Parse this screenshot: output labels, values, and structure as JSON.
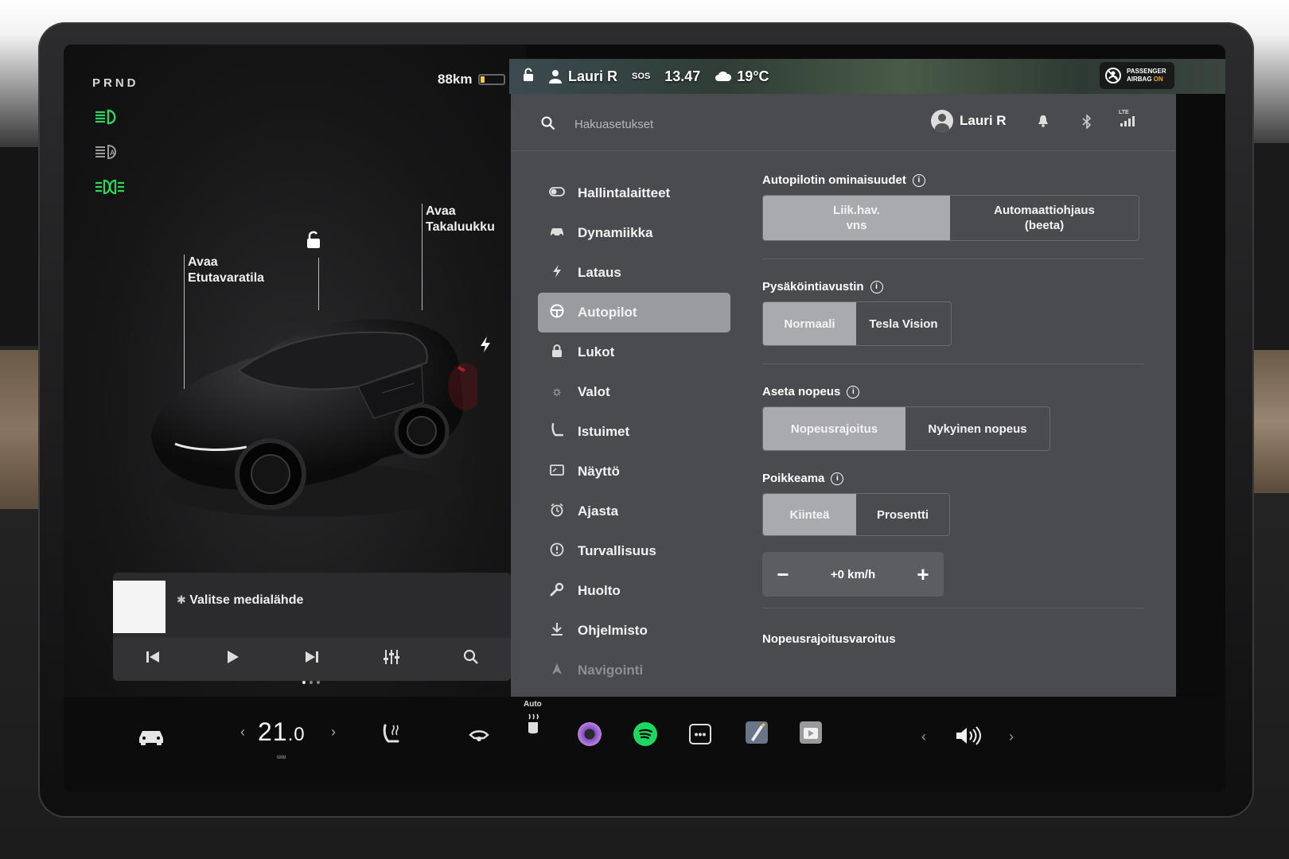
{
  "left": {
    "prnd": "PRND",
    "range": "88km",
    "callouts": {
      "frunk": [
        "Avaa",
        "Etutavaratila"
      ],
      "trunk": [
        "Avaa",
        "Takaluukku"
      ]
    },
    "media": {
      "source_label": "Valitse medialähde"
    }
  },
  "status": {
    "driver": "Lauri R",
    "sos": "SOS",
    "time": "13.47",
    "temperature": "19°C",
    "airbag_line1": "PASSENGER",
    "airbag_line2": "AIRBAG",
    "airbag_state": "ON"
  },
  "settings": {
    "search_placeholder": "Hakuasetukset",
    "user": "Lauri R",
    "lte": "LTE",
    "nav": [
      {
        "label": "Hallintalaitteet",
        "icon": "toggle-icon"
      },
      {
        "label": "Dynamiikka",
        "icon": "car-icon"
      },
      {
        "label": "Lataus",
        "icon": "bolt-icon"
      },
      {
        "label": "Autopilot",
        "icon": "steering-wheel-icon"
      },
      {
        "label": "Lukot",
        "icon": "lock-icon"
      },
      {
        "label": "Valot",
        "icon": "sun-icon"
      },
      {
        "label": "Istuimet",
        "icon": "seat-icon"
      },
      {
        "label": "Näyttö",
        "icon": "display-icon"
      },
      {
        "label": "Ajasta",
        "icon": "alarm-clock-icon"
      },
      {
        "label": "Turvallisuus",
        "icon": "alert-icon"
      },
      {
        "label": "Huolto",
        "icon": "wrench-icon"
      },
      {
        "label": "Ohjelmisto",
        "icon": "download-icon"
      },
      {
        "label": "Navigointi",
        "icon": "navigation-icon"
      }
    ],
    "active_nav": "Autopilot",
    "sections": {
      "autopilot_features": {
        "title": "Autopilotin ominaisuudet",
        "options": [
          "Liik.hav.\nvns",
          "Automaattiohjaus\n(beeta)"
        ],
        "selected": "Liik.hav.\nvns"
      },
      "park_assist": {
        "title": "Pysäköintiavustin",
        "options": [
          "Normaali",
          "Tesla Vision"
        ],
        "selected": "Normaali"
      },
      "set_speed": {
        "title": "Aseta nopeus",
        "options": [
          "Nopeusrajoitus",
          "Nykyinen nopeus"
        ],
        "selected": "Nopeusrajoitus"
      },
      "offset": {
        "title": "Poikkeama",
        "options": [
          "Kiinteä",
          "Prosentti"
        ],
        "selected": "Kiinteä",
        "value": "+0 km/h"
      },
      "speed_warning": {
        "title": "Nopeusrajoitusvaroitus"
      }
    }
  },
  "dock": {
    "cabin_temp_whole": "21",
    "cabin_temp_decimal": ".0",
    "seat_heat_auto": "Auto"
  },
  "colors": {
    "accent_green": "#32d35a",
    "panel_bg": "#4a4b4e",
    "selected_segment": "#a9aaad",
    "spotify_green": "#1ed760",
    "airbag_on": "#f2a33a"
  }
}
